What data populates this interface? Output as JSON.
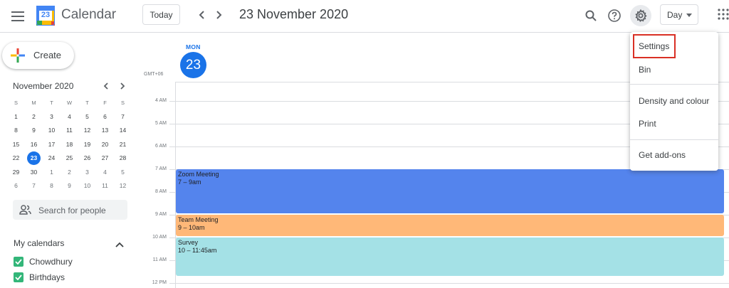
{
  "header": {
    "app_title": "Calendar",
    "logo_number": "23",
    "today_label": "Today",
    "date_title": "23 November 2020",
    "view_label": "Day"
  },
  "sidebar": {
    "create_label": "Create",
    "mini_calendar": {
      "month_label": "November 2020",
      "weekdays": [
        "S",
        "M",
        "T",
        "W",
        "T",
        "F",
        "S"
      ],
      "weeks": [
        [
          "1",
          "2",
          "3",
          "4",
          "5",
          "6",
          "7"
        ],
        [
          "8",
          "9",
          "10",
          "11",
          "12",
          "13",
          "14"
        ],
        [
          "15",
          "16",
          "17",
          "18",
          "19",
          "20",
          "21"
        ],
        [
          "22",
          "23",
          "24",
          "25",
          "26",
          "27",
          "28"
        ],
        [
          "29",
          "30",
          "1",
          "2",
          "3",
          "4",
          "5"
        ],
        [
          "6",
          "7",
          "8",
          "9",
          "10",
          "11",
          "12"
        ]
      ],
      "today": "23"
    },
    "search_people_placeholder": "Search for people",
    "my_calendars_title": "My calendars",
    "calendars": [
      {
        "label": "Chowdhury",
        "color": "#33b679",
        "checked": true
      },
      {
        "label": "Birthdays",
        "color": "#33b679",
        "checked": true
      }
    ]
  },
  "day_view": {
    "day_of_week": "MON",
    "day_number": "23",
    "timezone": "GMT+06",
    "hours": [
      "4 AM",
      "5 AM",
      "6 AM",
      "7 AM",
      "8 AM",
      "9 AM",
      "10 AM",
      "11 AM",
      "12 PM"
    ]
  },
  "events": [
    {
      "title": "Zoom Meeting",
      "time": "7 – 9am",
      "color": "#5484ed"
    },
    {
      "title": "Team Meeting",
      "time": "9 – 10am",
      "color": "#ffb878"
    },
    {
      "title": "Survey",
      "time": "10 – 11:45am",
      "color": "#a4e1e6"
    }
  ],
  "settings_menu": {
    "items": [
      "Settings",
      "Bin",
      "Density and colour",
      "Print",
      "Get add-ons"
    ],
    "highlighted": "Settings"
  }
}
